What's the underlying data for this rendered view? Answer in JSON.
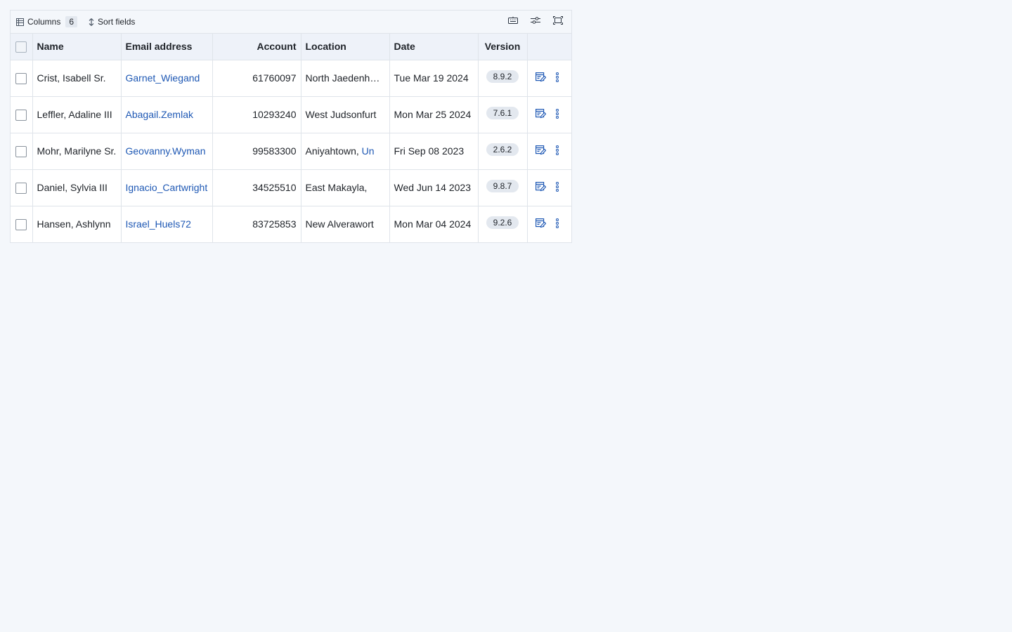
{
  "toolbar": {
    "columns_label": "Columns",
    "columns_count": "6",
    "sort_label": "Sort fields"
  },
  "table": {
    "headers": {
      "name": "Name",
      "email": "Email address",
      "account": "Account",
      "location": "Location",
      "date": "Date",
      "version": "Version"
    },
    "rows": [
      {
        "name": "Crist, Isabell Sr.",
        "email": "Garnet_Wiegand",
        "account": "61760097",
        "location": "North Jaedenhaven",
        "location_link": "",
        "date": "Tue Mar 19 2024",
        "version": "8.9.2"
      },
      {
        "name": "Leffler, Adaline III",
        "email": "Abagail.Zemlak",
        "account": "10293240",
        "location": "West Judsonfurt",
        "location_link": "",
        "date": "Mon Mar 25 2024",
        "version": "7.6.1"
      },
      {
        "name": "Mohr, Marilyne Sr.",
        "email": "Geovanny.Wyman",
        "account": "99583300",
        "location": "Aniyahtown, ",
        "location_link": "Un",
        "date": "Fri Sep 08 2023",
        "version": "2.6.2"
      },
      {
        "name": "Daniel, Sylvia III",
        "email": "Ignacio_Cartwright",
        "account": "34525510",
        "location": "East Makayla, ",
        "location_link": "",
        "date": "Wed Jun 14 2023",
        "version": "9.8.7"
      },
      {
        "name": "Hansen, Ashlynn",
        "email": "Israel_Huels72",
        "account": "83725853",
        "location": "New Alverawort",
        "location_link": "",
        "date": "Mon Mar 04 2024",
        "version": "9.2.6"
      }
    ]
  },
  "colors": {
    "link": "#1e58b4",
    "accent": "#1e58b4",
    "background": "#f4f7fb"
  },
  "icons": {
    "columns": "table-columns-icon",
    "sort": "sort-arrows-icon",
    "density": "keyboard-icon",
    "filter": "sliders-icon",
    "fullscreen": "fullscreen-icon",
    "edit": "edit-icon",
    "more": "more-vertical-icon"
  }
}
